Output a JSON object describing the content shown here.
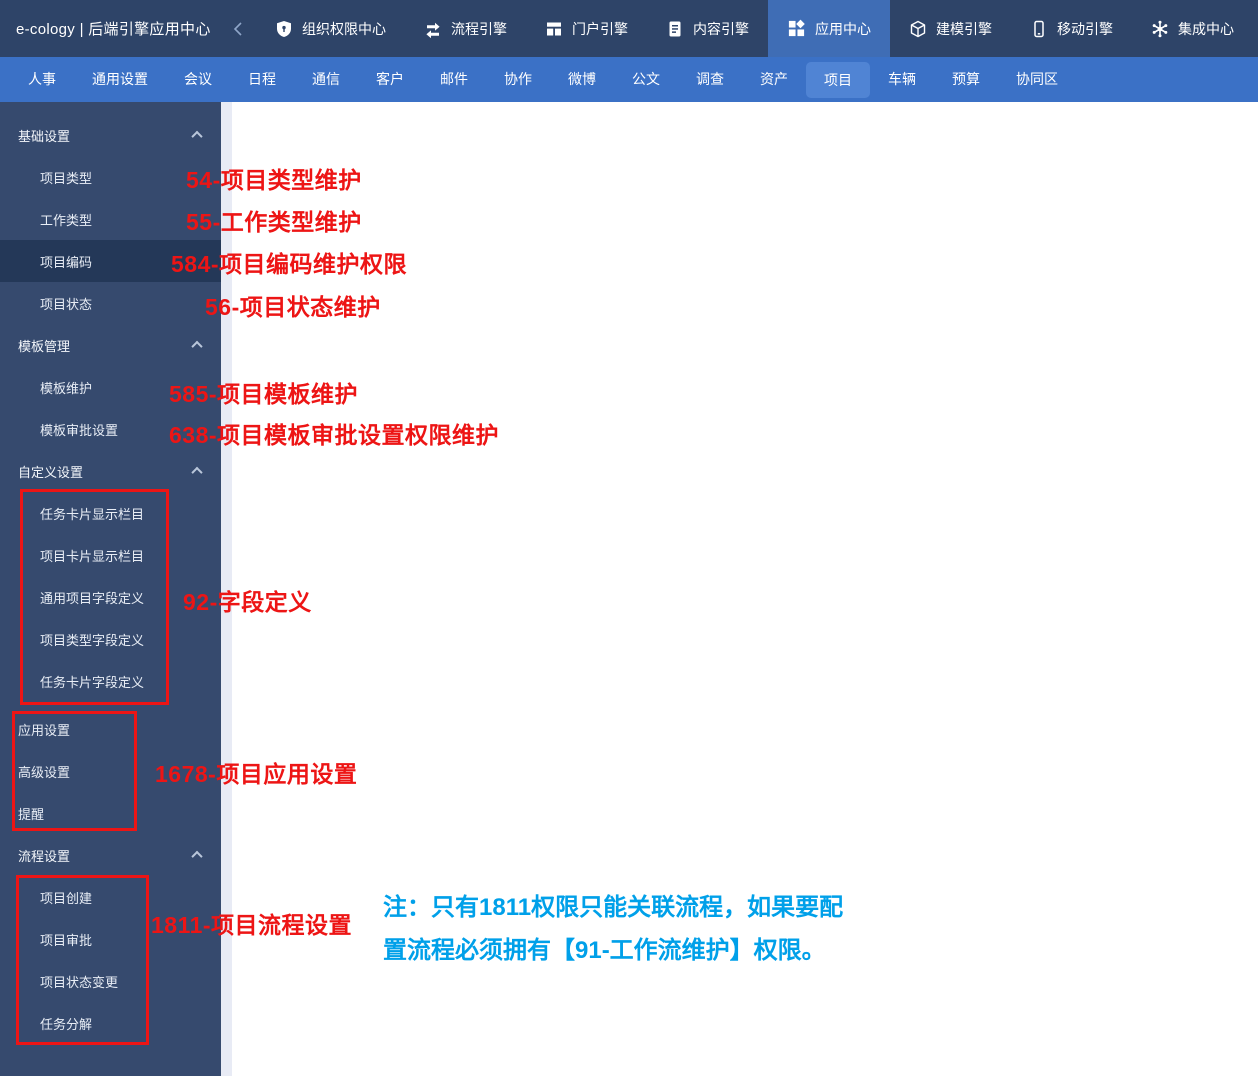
{
  "topbar": {
    "logo": "e-cology | 后端引擎应用中心",
    "items": [
      {
        "label": "组织权限中心",
        "icon": "shield-icon",
        "selected": false
      },
      {
        "label": "流程引擎",
        "icon": "flow-arrows-icon",
        "selected": false
      },
      {
        "label": "门户引擎",
        "icon": "portal-layout-icon",
        "selected": false
      },
      {
        "label": "内容引擎",
        "icon": "document-icon",
        "selected": false
      },
      {
        "label": "应用中心",
        "icon": "app-grid-icon",
        "selected": true
      },
      {
        "label": "建模引擎",
        "icon": "cube-icon",
        "selected": false
      },
      {
        "label": "移动引擎",
        "icon": "mobile-phone-icon",
        "selected": false
      },
      {
        "label": "集成中心",
        "icon": "integration-hub-icon",
        "selected": false
      }
    ]
  },
  "subnav": {
    "items": [
      {
        "label": "人事",
        "selected": false
      },
      {
        "label": "通用设置",
        "selected": false
      },
      {
        "label": "会议",
        "selected": false
      },
      {
        "label": "日程",
        "selected": false
      },
      {
        "label": "通信",
        "selected": false
      },
      {
        "label": "客户",
        "selected": false
      },
      {
        "label": "邮件",
        "selected": false
      },
      {
        "label": "协作",
        "selected": false
      },
      {
        "label": "微博",
        "selected": false
      },
      {
        "label": "公文",
        "selected": false
      },
      {
        "label": "调查",
        "selected": false
      },
      {
        "label": "资产",
        "selected": false
      },
      {
        "label": "项目",
        "selected": true
      },
      {
        "label": "车辆",
        "selected": false
      },
      {
        "label": "预算",
        "selected": false
      },
      {
        "label": "协同区",
        "selected": false
      }
    ]
  },
  "sidebar": {
    "rows": [
      {
        "type": "header",
        "label": "基础设置"
      },
      {
        "type": "item",
        "label": "项目类型"
      },
      {
        "type": "item",
        "label": "工作类型"
      },
      {
        "type": "item",
        "label": "项目编码",
        "selected": true
      },
      {
        "type": "item",
        "label": "项目状态"
      },
      {
        "type": "header",
        "label": "模板管理"
      },
      {
        "type": "item",
        "label": "模板维护"
      },
      {
        "type": "item",
        "label": "模板审批设置"
      },
      {
        "type": "header",
        "label": "自定义设置"
      },
      {
        "type": "item",
        "label": "任务卡片显示栏目"
      },
      {
        "type": "item",
        "label": "项目卡片显示栏目"
      },
      {
        "type": "item",
        "label": "通用项目字段定义"
      },
      {
        "type": "item",
        "label": "项目类型字段定义"
      },
      {
        "type": "item",
        "label": "任务卡片字段定义"
      },
      {
        "type": "toplevel",
        "label": "应用设置"
      },
      {
        "type": "toplevel",
        "label": "高级设置"
      },
      {
        "type": "toplevel",
        "label": "提醒"
      },
      {
        "type": "header",
        "label": "流程设置"
      },
      {
        "type": "item",
        "label": "项目创建"
      },
      {
        "type": "item",
        "label": "项目审批"
      },
      {
        "type": "item",
        "label": "项目状态变更"
      },
      {
        "type": "item",
        "label": "任务分解"
      }
    ]
  },
  "annotations": {
    "red": [
      {
        "text": "54-项目类型维护"
      },
      {
        "text": "55-工作类型维护"
      },
      {
        "text": "584-项目编码维护权限"
      },
      {
        "text": "56-项目状态维护"
      },
      {
        "text": "585-项目模板维护"
      },
      {
        "text": "638-项目模板审批设置权限维护"
      },
      {
        "text": "92-字段定义"
      },
      {
        "text": "1678-项目应用设置"
      },
      {
        "text": "1811-项目流程设置"
      }
    ],
    "note_lines": [
      "注：只有1811权限只能关联流程，如果要配",
      "置流程必须拥有【91-工作流维护】权限。"
    ]
  },
  "colors": {
    "topbar_bg": "#2e4468",
    "topbar_selected_bg": "#3f6db5",
    "subnav_bg": "#3b71c6",
    "subnav_selected_bg": "#5084d4",
    "sidebar_bg": "#364a6e",
    "sidebar_selected_bg": "#243858",
    "annotation_red": "#ed1515",
    "note_blue": "#00a0e9"
  }
}
